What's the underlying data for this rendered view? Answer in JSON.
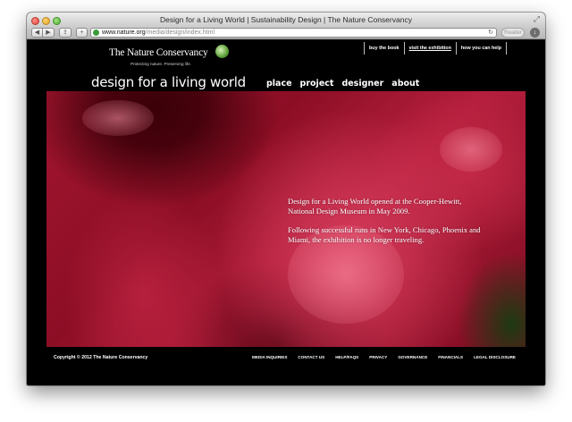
{
  "window": {
    "title": "Design for a Living World | Sustainability Design | The Nature Conservancy",
    "url_host": "www.nature.org",
    "url_path": "/media/design/index.html",
    "reader_label": "Reader"
  },
  "site": {
    "logo_text": "The Nature Conservancy",
    "logo_tagline": "Protecting nature. Preserving life.",
    "title": "design for a living world"
  },
  "utility_nav": [
    {
      "label": "buy the book"
    },
    {
      "label": "visit the exhibition"
    },
    {
      "label": "how you can help"
    }
  ],
  "main_nav": [
    {
      "label": "place"
    },
    {
      "label": "project"
    },
    {
      "label": "designer"
    },
    {
      "label": "about"
    }
  ],
  "hero": {
    "paragraph1": "Design for a Living World opened at the Cooper-Hewitt, National Design Museum in May 2009.",
    "paragraph2": "Following successful runs in New York, Chicago, Phoenix and Miami, the exhibition is no longer traveling."
  },
  "footer": {
    "copyright": "Copyright © 2012 The Nature Conservancy",
    "links": [
      {
        "label": "MEDIA INQUIRIES"
      },
      {
        "label": "CONTACT US"
      },
      {
        "label": "HELP/FAQS"
      },
      {
        "label": "PRIVACY"
      },
      {
        "label": "GOVERNANCE"
      },
      {
        "label": "FINANCIALS"
      },
      {
        "label": "LEGAL DISCLOSURE"
      }
    ]
  },
  "colors": {
    "page_background": "#000000",
    "hero_red": "#a2152f"
  }
}
